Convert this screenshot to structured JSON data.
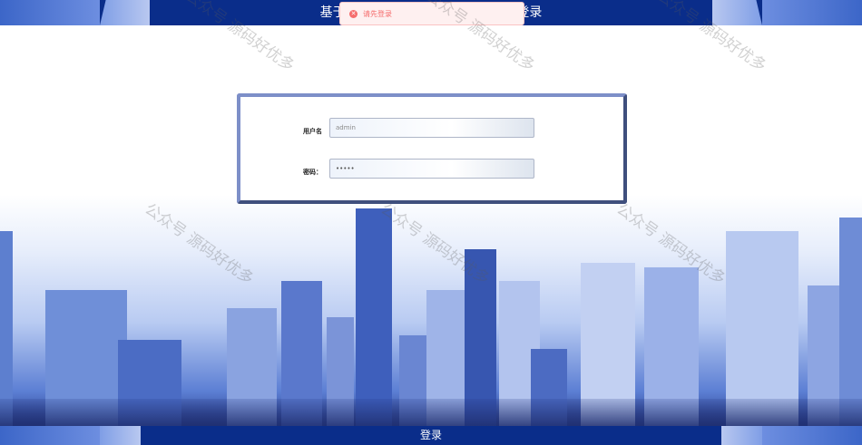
{
  "header": {
    "title": "基于uni-app的XX系统设计与实现 登录"
  },
  "toast": {
    "message": "请先登录",
    "type": "error",
    "icon": "error-circle-icon",
    "color": "#f56c6c"
  },
  "form": {
    "username": {
      "label": "用户名",
      "value": "admin"
    },
    "password": {
      "label": "密码：",
      "value": "•••••"
    }
  },
  "footer": {
    "login_label": "登录"
  },
  "watermark": {
    "text": "公众号 源码好优多"
  },
  "colors": {
    "header_bg": "#0a2d8a",
    "card_border": "#7d8fc8",
    "error": "#f56c6c"
  }
}
